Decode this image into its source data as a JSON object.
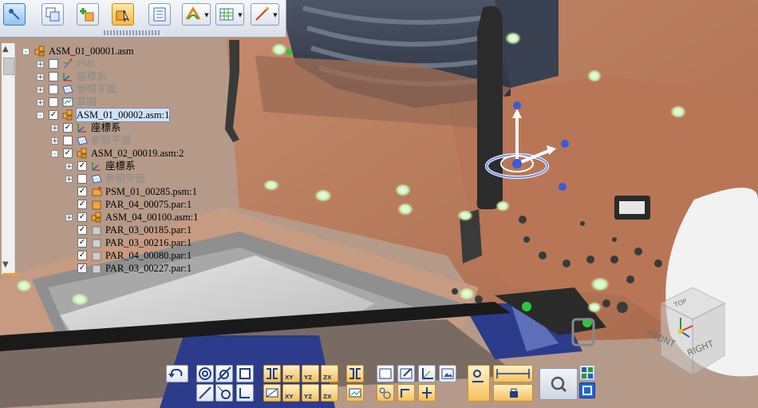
{
  "tree": {
    "rows": [
      {
        "label": "ASM_01_00001.asm",
        "indent": 0,
        "expander": "-",
        "checked": null,
        "icon": "assembly-icon",
        "dim": false,
        "selected": false
      },
      {
        "label": "PMI",
        "indent": 1,
        "expander": "+",
        "checked": false,
        "icon": "pmi-icon",
        "dim": true,
        "selected": false
      },
      {
        "label": "座標系",
        "indent": 1,
        "expander": "+",
        "checked": false,
        "icon": "coordinate-system-icon",
        "dim": true,
        "selected": false
      },
      {
        "label": "參照平面",
        "indent": 1,
        "expander": "+",
        "checked": false,
        "icon": "reference-plane-icon",
        "dim": true,
        "selected": false
      },
      {
        "label": "草圖",
        "indent": 1,
        "expander": "+",
        "checked": false,
        "icon": "sketch-icon",
        "dim": true,
        "selected": false
      },
      {
        "label": "ASM_01_00002.asm:1",
        "indent": 1,
        "expander": "-",
        "checked": true,
        "icon": "assembly-icon",
        "dim": false,
        "selected": true
      },
      {
        "label": "座標系",
        "indent": 2,
        "expander": "+",
        "checked": true,
        "icon": "coordinate-system-icon",
        "dim": false,
        "selected": false
      },
      {
        "label": "參照平面",
        "indent": 2,
        "expander": "+",
        "checked": false,
        "icon": "reference-plane-icon",
        "dim": true,
        "selected": false
      },
      {
        "label": "ASM_02_00019.asm:2",
        "indent": 2,
        "expander": "-",
        "checked": true,
        "icon": "assembly-icon",
        "dim": false,
        "selected": false
      },
      {
        "label": "座標系",
        "indent": 3,
        "expander": "+",
        "checked": true,
        "icon": "coordinate-system-icon",
        "dim": false,
        "selected": false
      },
      {
        "label": "參照平面",
        "indent": 3,
        "expander": "+",
        "checked": false,
        "icon": "reference-plane-icon",
        "dim": true,
        "selected": false
      },
      {
        "label": "PSM_01_00285.psm:1",
        "indent": 3,
        "expander": null,
        "checked": true,
        "icon": "sheetmetal-icon",
        "dim": false,
        "selected": false
      },
      {
        "label": "PAR_04_00075.par:1",
        "indent": 3,
        "expander": null,
        "checked": true,
        "icon": "part-icon",
        "dim": false,
        "selected": false
      },
      {
        "label": "ASM_04_00100.asm:1",
        "indent": 3,
        "expander": "+",
        "checked": true,
        "icon": "assembly-icon",
        "dim": false,
        "selected": false
      },
      {
        "label": "PAR_03_00185.par:1",
        "indent": 3,
        "expander": null,
        "checked": true,
        "icon": "part-gray-icon",
        "dim": false,
        "selected": false
      },
      {
        "label": "PAR_03_00216.par:1",
        "indent": 3,
        "expander": null,
        "checked": true,
        "icon": "part-gray-icon",
        "dim": false,
        "selected": false
      },
      {
        "label": "PAR_04_00080.par:1",
        "indent": 3,
        "expander": null,
        "checked": true,
        "icon": "part-gray-icon",
        "dim": false,
        "selected": false
      },
      {
        "label": "PAR_03_00227.par:1",
        "indent": 3,
        "expander": null,
        "checked": true,
        "icon": "part-gray-icon",
        "dim": false,
        "selected": false
      }
    ]
  },
  "toolbar": {
    "buttons": [
      {
        "name": "select-tool-button",
        "icon": "select-arrow-icon",
        "state": "first"
      },
      {
        "name": "copy-components-button",
        "icon": "copy-squares-icon",
        "state": "normal"
      },
      {
        "name": "insert-component-button",
        "icon": "insert-part-icon",
        "state": "normal"
      },
      {
        "name": "drag-component-button",
        "icon": "drag-cursor-icon",
        "state": "active"
      },
      {
        "name": "properties-button",
        "icon": "list-properties-icon",
        "state": "normal"
      },
      {
        "name": "relationship-button",
        "icon": "relationship-icon",
        "state": "normal"
      },
      {
        "name": "view-style-button",
        "icon": "grid-view-icon",
        "state": "normal"
      },
      {
        "name": "sketch-line-button",
        "icon": "line-tool-icon",
        "state": "normal"
      }
    ]
  },
  "cmdbar": {
    "labels": [
      "XY",
      "YZ",
      "ZX",
      "XY",
      "YZ",
      "ZX"
    ]
  },
  "viewcube": {
    "top": "TOP",
    "front": "FRONT",
    "right": "RIGHT"
  }
}
